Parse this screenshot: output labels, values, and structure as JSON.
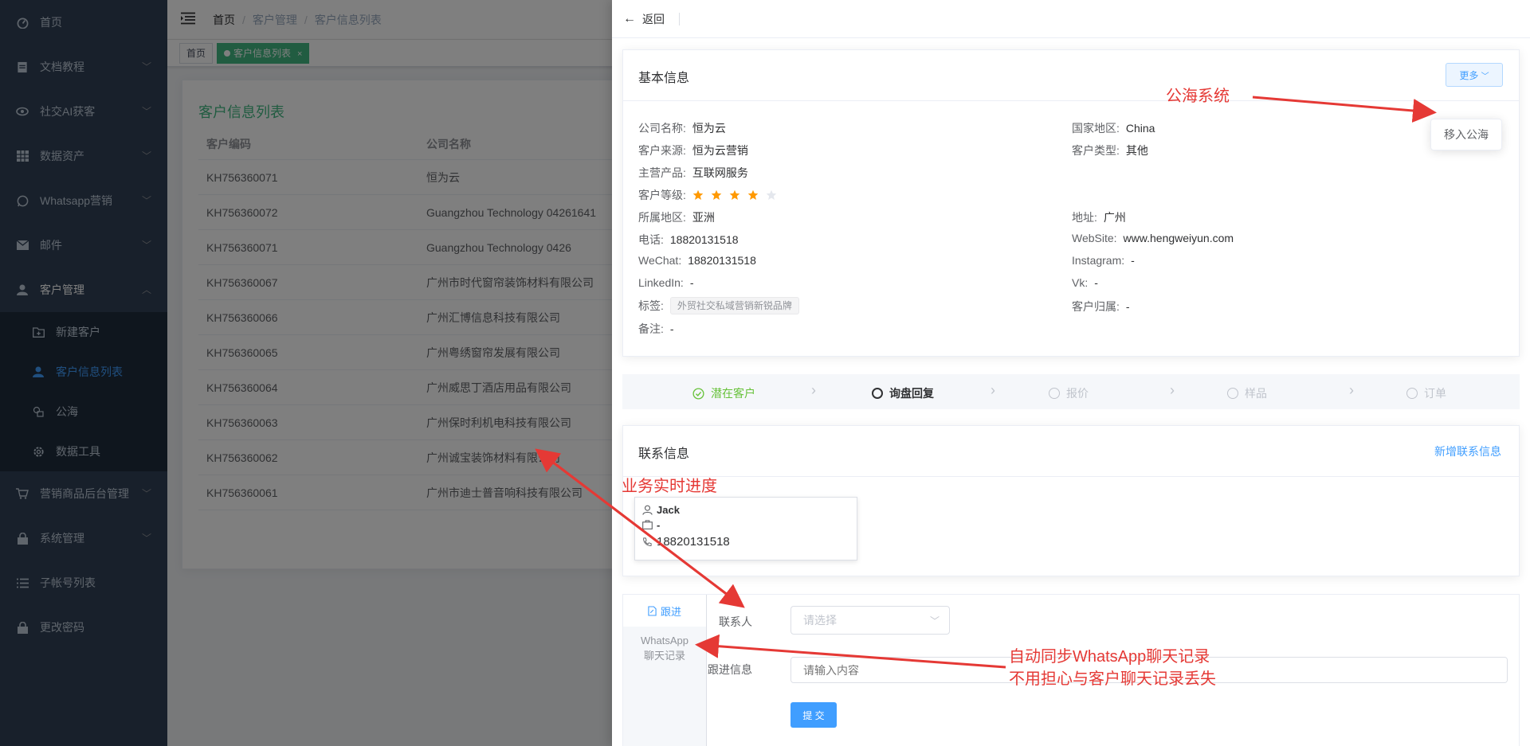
{
  "sidebar": {
    "items": [
      {
        "label": "首页",
        "icon": "dashboard-icon"
      },
      {
        "label": "文档教程",
        "icon": "document-icon"
      },
      {
        "label": "社交AI获客",
        "icon": "eye-icon"
      },
      {
        "label": "数据资产",
        "icon": "table-icon"
      },
      {
        "label": "Whatsapp营销",
        "icon": "whatsapp-icon"
      },
      {
        "label": "邮件",
        "icon": "mail-icon"
      },
      {
        "label": "客户管理",
        "icon": "user-icon"
      }
    ],
    "sub_items": [
      {
        "label": "新建客户",
        "icon": "folder-add-icon"
      },
      {
        "label": "客户信息列表",
        "icon": "user-icon"
      },
      {
        "label": "公海",
        "icon": "sea-icon"
      },
      {
        "label": "数据工具",
        "icon": "gear-icon"
      }
    ],
    "after_items": [
      {
        "label": "营销商品后台管理",
        "icon": "cart-icon"
      },
      {
        "label": "系统管理",
        "icon": "lock-icon"
      },
      {
        "label": "子帐号列表",
        "icon": "list-icon"
      },
      {
        "label": "更改密码",
        "icon": "lock-icon"
      }
    ]
  },
  "breadcrumb": {
    "home": "首页",
    "section": "客户管理",
    "page": "客户信息列表"
  },
  "tags": {
    "home": "首页",
    "active": "客户信息列表"
  },
  "list": {
    "title": "客户信息列表",
    "col_code": "客户编码",
    "col_company": "公司名称",
    "rows": [
      {
        "code": "KH756360071",
        "company": "恒为云"
      },
      {
        "code": "KH756360072",
        "company": "Guangzhou Technology 04261641"
      },
      {
        "code": "KH756360071",
        "company": "Guangzhou Technology 0426"
      },
      {
        "code": "KH756360067",
        "company": "广州市时代窗帘装饰材料有限公司"
      },
      {
        "code": "KH756360066",
        "company": "广州汇博信息科技有限公司"
      },
      {
        "code": "KH756360065",
        "company": "广州粤绣窗帘发展有限公司"
      },
      {
        "code": "KH756360064",
        "company": "广州威思丁酒店用品有限公司"
      },
      {
        "code": "KH756360063",
        "company": "广州保时利机电科技有限公司"
      },
      {
        "code": "KH756360062",
        "company": "广州诚宝装饰材料有限公司"
      },
      {
        "code": "KH756360061",
        "company": "广州市迪士普音响科技有限公司"
      }
    ]
  },
  "drawer": {
    "back": "返回",
    "basic": {
      "title": "基本信息",
      "more": "更多",
      "dropdown_item": "移入公海",
      "company_lbl": "公司名称:",
      "company": "恒为云",
      "country_lbl": "国家地区:",
      "country": "China",
      "source_lbl": "客户来源:",
      "source": "恒为云营销",
      "type_lbl": "客户类型:",
      "type": "其他",
      "product_lbl": "主营产品:",
      "product": "互联网服务",
      "level_lbl": "客户等级:",
      "level": 4,
      "level_max": 5,
      "region_lbl": "所属地区:",
      "region": "亚洲",
      "address_lbl": "地址:",
      "address": "广州",
      "phone_lbl": "电话:",
      "phone": "18820131518",
      "website_lbl": "WebSite:",
      "website": "www.hengweiyun.com",
      "wechat_lbl": "WeChat:",
      "wechat": "18820131518",
      "instagram_lbl": "Instagram:",
      "instagram": "-",
      "linkedin_lbl": "LinkedIn:",
      "linkedin": "-",
      "vk_lbl": "Vk:",
      "vk": "-",
      "tag_lbl": "标签:",
      "tag": "外贸社交私域营销新锐品牌",
      "owner_lbl": "客户归属:",
      "owner": "-",
      "remark_lbl": "备注:",
      "remark": "-"
    },
    "steps": [
      "潜在客户",
      "询盘回复",
      "报价",
      "样品",
      "订单"
    ],
    "contact": {
      "title": "联系信息",
      "add": "新增联系信息",
      "name": "Jack",
      "company": "-",
      "phone": "18820131518"
    },
    "followup": {
      "tab_follow": "跟进",
      "tab_whatsapp_1": "WhatsApp",
      "tab_whatsapp_2": "聊天记录",
      "contact_lbl": "联系人",
      "contact_placeholder": "请选择",
      "info_lbl": "跟进信息",
      "info_placeholder": "请输入内容",
      "submit": "提 交"
    }
  },
  "annotations": {
    "sea": "公海系统",
    "progress": "业务实时进度",
    "whatsapp_1": "自动同步WhatsApp聊天记录",
    "whatsapp_2": "不用担心与客户聊天记录丢失"
  },
  "colors": {
    "sidebar": "#304156",
    "accent": "#409eff",
    "success": "#67c23a",
    "annotation": "#e53935",
    "star": "#ff9900"
  }
}
